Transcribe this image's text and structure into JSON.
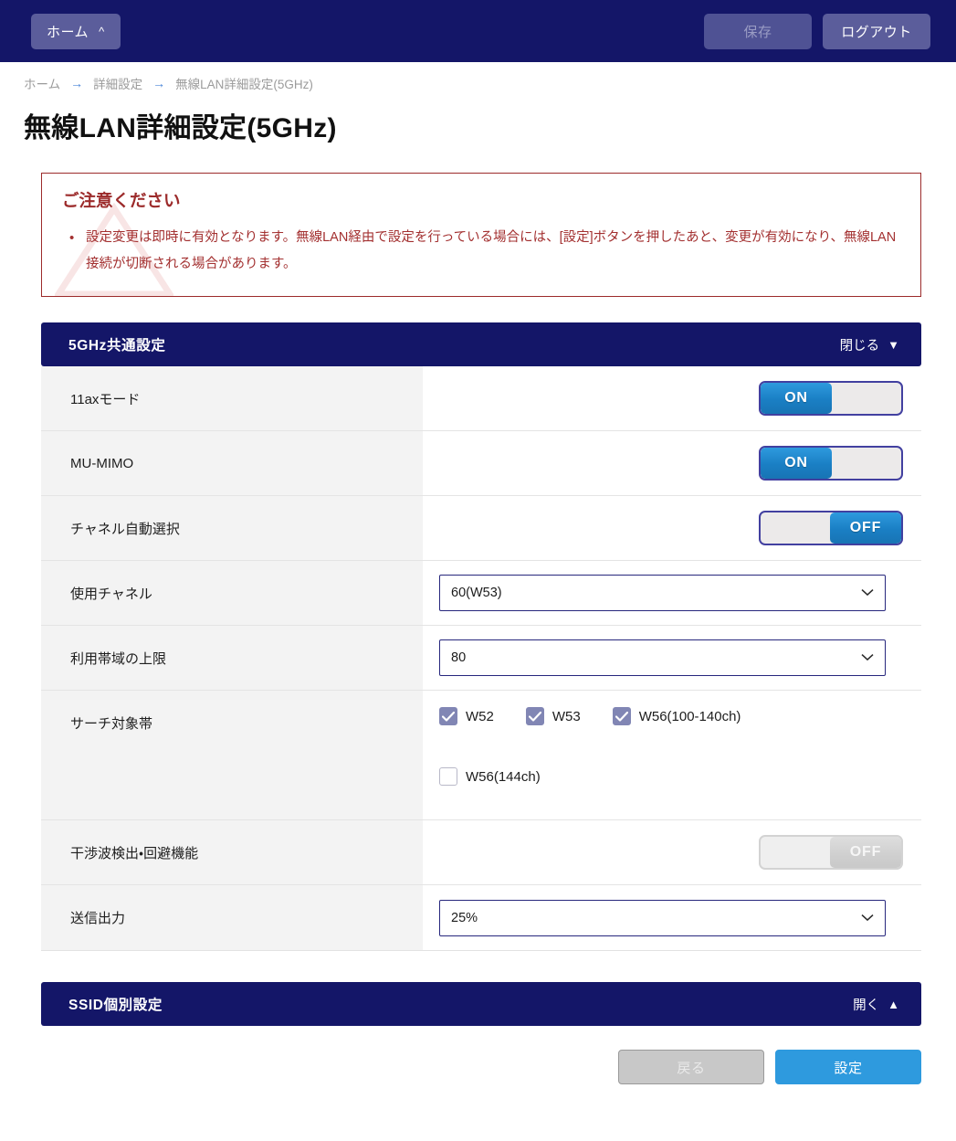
{
  "topbar": {
    "home_label": "ホーム",
    "home_caret": "chevron-up",
    "save_label": "保存",
    "save_disabled": true,
    "logout_label": "ログアウト"
  },
  "breadcrumb": {
    "items": [
      "ホーム",
      "詳細設定",
      "無線LAN詳細設定(5GHz)"
    ],
    "separator": "→"
  },
  "page": {
    "title": "無線LAN詳細設定(5GHz)"
  },
  "warning": {
    "title": "ご注意ください",
    "items": [
      "設定変更は即時に有効となります。無線LAN経由で設定を行っている場合には、[設定]ボタンを押したあと、変更が有効になり、無線LAN接続が切断される場合があります。"
    ]
  },
  "section_common": {
    "title": "5GHz共通設定",
    "toggle_label": "閉じる",
    "toggle_state": "expanded",
    "rows": [
      {
        "label": "11axモード",
        "control": "toggle",
        "value": "ON",
        "enabled": true
      },
      {
        "label": "MU-MIMO",
        "control": "toggle",
        "value": "ON",
        "enabled": true
      },
      {
        "label": "チャネル自動選択",
        "control": "toggle",
        "value": "OFF",
        "enabled": true
      },
      {
        "label": "使用チャネル",
        "control": "select",
        "value": "60(W53)"
      },
      {
        "label": "利用帯域の上限",
        "control": "select",
        "value": "80"
      },
      {
        "label": "サーチ対象帯",
        "control": "checkboxes"
      },
      {
        "label": "干渉波検出・回避機能",
        "control": "toggle",
        "value": "OFF",
        "enabled": false
      },
      {
        "label": "送信出力",
        "control": "select",
        "value": "25%"
      }
    ],
    "search_bands": [
      {
        "label": "W52",
        "checked": true
      },
      {
        "label": "W53",
        "checked": true
      },
      {
        "label": "W56(100-140ch)",
        "checked": true
      },
      {
        "label": "W56(144ch)",
        "checked": false
      }
    ]
  },
  "section_ssid": {
    "title": "SSID個別設定",
    "toggle_label": "開く",
    "toggle_state": "collapsed"
  },
  "footer": {
    "back_label": "戻る",
    "back_disabled": true,
    "apply_label": "設定"
  },
  "colors": {
    "navy": "#141668",
    "accent_blue": "#2e9ade",
    "warning_red": "#9c2b2b",
    "label_bg": "#f3f3f3",
    "checkbox_checked": "#8186b4"
  }
}
